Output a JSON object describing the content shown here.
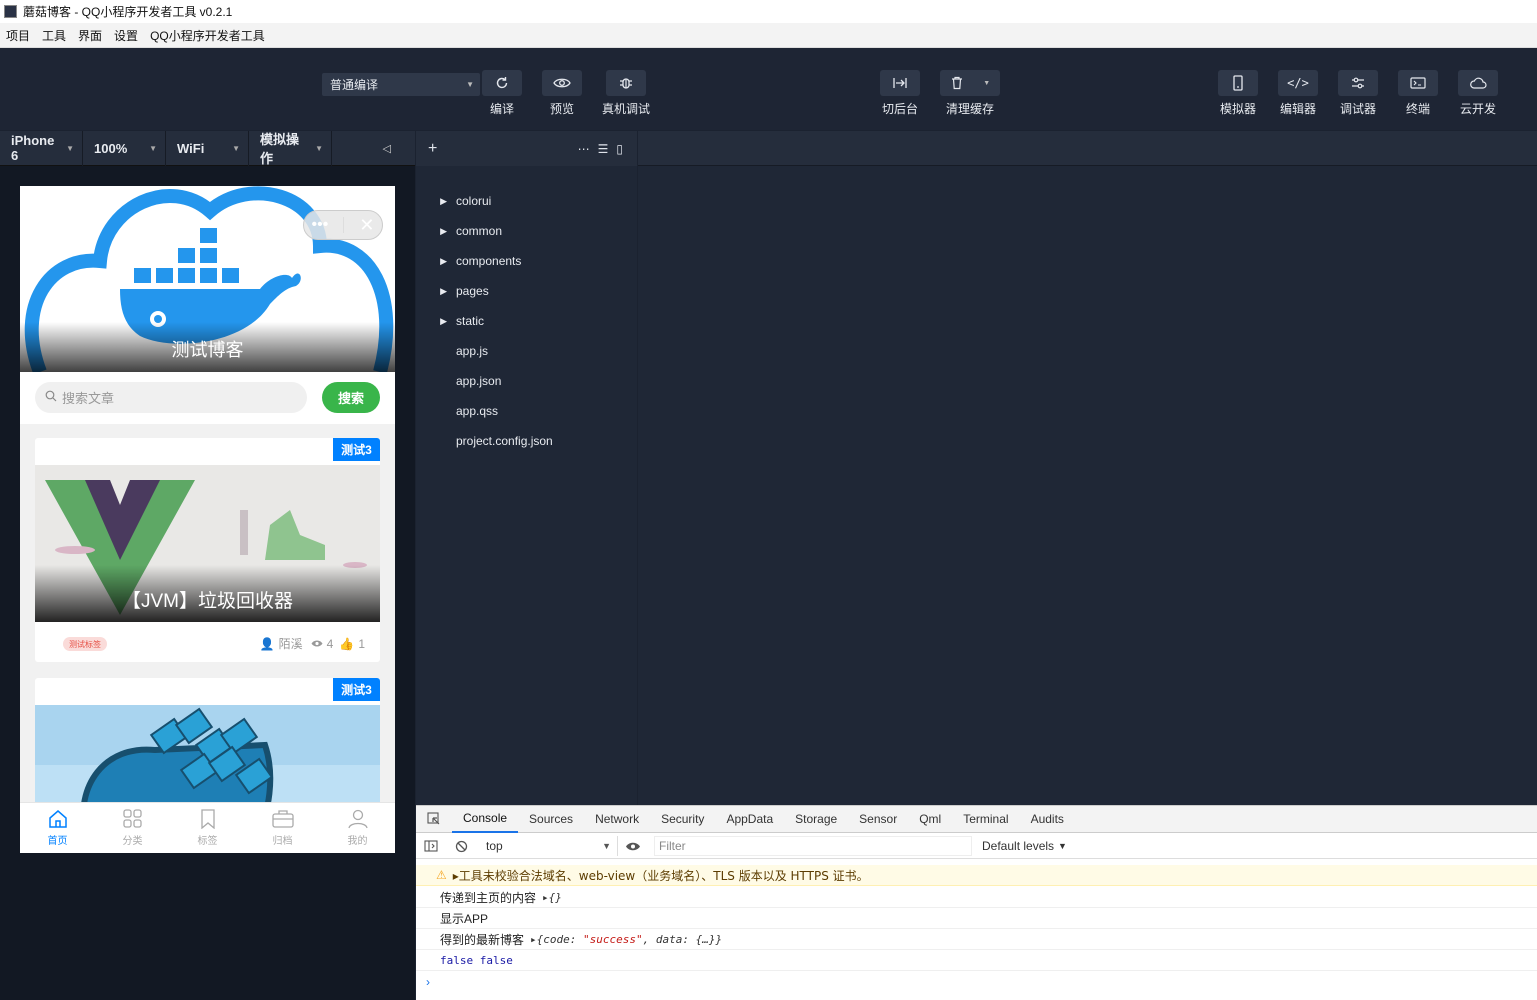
{
  "window": {
    "title": "蘑菇博客 - QQ小程序开发者工具 v0.2.1"
  },
  "menu": [
    "项目",
    "工具",
    "界面",
    "设置",
    "QQ小程序开发者工具"
  ],
  "toolbar": {
    "compile_mode": "普通编译",
    "left_buttons": [
      {
        "label": "编译",
        "icon": "refresh-icon"
      },
      {
        "label": "预览",
        "icon": "eye-icon"
      },
      {
        "label": "真机调试",
        "icon": "bug-icon"
      }
    ],
    "middle_buttons": [
      {
        "label": "切后台",
        "icon": "switch-background-icon"
      },
      {
        "label": "清理缓存",
        "icon": "trash-icon"
      }
    ],
    "right_buttons": [
      {
        "label": "模拟器",
        "icon": "phone-icon"
      },
      {
        "label": "编辑器",
        "icon": "code-icon"
      },
      {
        "label": "调试器",
        "icon": "sliders-icon"
      },
      {
        "label": "终端",
        "icon": "terminal-icon"
      },
      {
        "label": "云开发",
        "icon": "cloud-icon"
      }
    ]
  },
  "simulator_bar": {
    "device": "iPhone 6",
    "zoom": "100%",
    "network": "WiFi",
    "operation": "模拟操作"
  },
  "file_tree": {
    "folders": [
      "colorui",
      "common",
      "components",
      "pages",
      "static"
    ],
    "files": [
      "app.js",
      "app.json",
      "app.qss",
      "project.config.json"
    ]
  },
  "phone": {
    "banner_title": "测试博客",
    "search_placeholder": "搜索文章",
    "search_button": "搜索",
    "cards": [
      {
        "badge": "测试3",
        "title": "【JVM】垃圾回收器",
        "tag": "测试标签",
        "author": "陌溪",
        "views": "4",
        "likes": "1"
      },
      {
        "badge": "测试3"
      }
    ],
    "tabs": [
      "首页",
      "分类",
      "标签",
      "归档",
      "我的"
    ]
  },
  "devtools": {
    "tabs": [
      "Console",
      "Sources",
      "Network",
      "Security",
      "AppData",
      "Storage",
      "Sensor",
      "Qml",
      "Terminal",
      "Audits"
    ],
    "context": "top",
    "filter_placeholder": "Filter",
    "levels": "Default levels",
    "logs": {
      "warning": "▸工具未校验合法域名、web-view（业务域名）、TLS 版本以及 HTTPS 证书。",
      "l1_text": "传递到主页的内容",
      "l1_obj": "▸{}",
      "l2_text": "显示APP",
      "l3_text": "得到的最新博客",
      "l3_obj_pre": "▸{code: ",
      "l3_obj_str": "\"success\"",
      "l3_obj_post": ", data: {…}}",
      "l4_text": "false false"
    }
  },
  "colors": {
    "accent": "#0081ff",
    "search_green": "#39b54a",
    "panel_bg": "#1f2736",
    "toolbar_bg": "#1e2534"
  }
}
